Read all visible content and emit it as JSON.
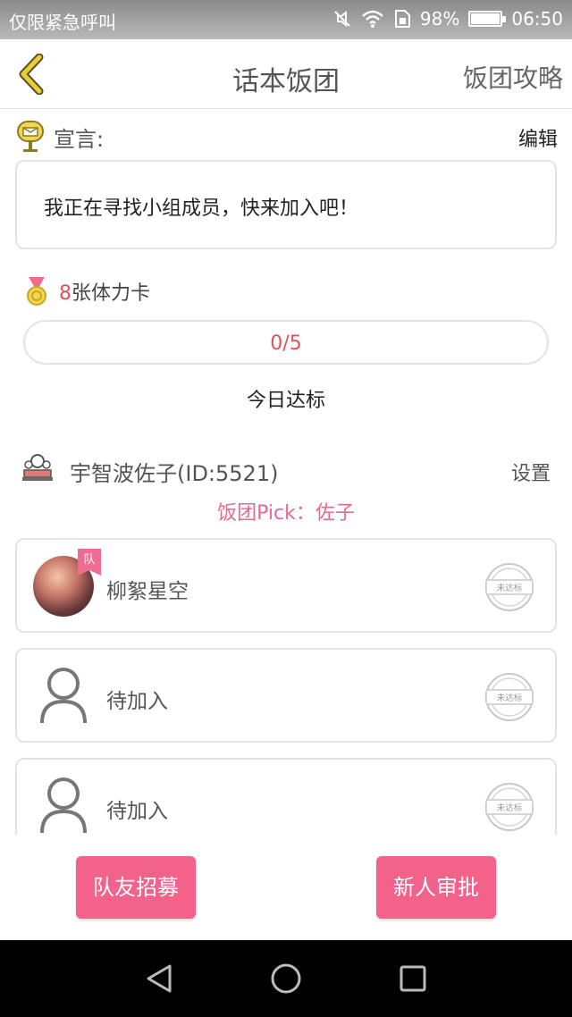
{
  "status_bar": {
    "left_text": "仅限紧急呼叫",
    "battery_text": "98%",
    "battery_level": 0.98,
    "time": "06:50",
    "icons": [
      "mute-icon",
      "wifi-icon",
      "sim-icon",
      "battery-icon"
    ]
  },
  "header": {
    "title": "话本饭团",
    "right_link": "饭团攻略",
    "back_icon": "chevron-left-icon",
    "accent_color": "#e8cf3a"
  },
  "declaration": {
    "label": "宣言:",
    "edit": "编辑",
    "text": "我正在寻找小组成员，快来加入吧！"
  },
  "cards": {
    "count": "8",
    "suffix": "张体力卡",
    "progress_text": "0/5",
    "progress_fraction": 0,
    "daily_label": "今日达标"
  },
  "team": {
    "name": "宇智波佐子(ID:5521)",
    "settings": "设置",
    "pick": "饭团Pick：佐子",
    "members": [
      {
        "name": "柳絮星空",
        "captain_badge": "队",
        "stamp": "未达标",
        "has_avatar": true
      },
      {
        "name": "待加入",
        "stamp": "未达标",
        "has_avatar": false
      },
      {
        "name": "待加入",
        "stamp": "未达标",
        "has_avatar": false
      }
    ]
  },
  "actions": {
    "recruit": "队友招募",
    "approve": "新人审批",
    "button_color": "#f2628a"
  },
  "nav_bar": {
    "icons": [
      "back-triangle-icon",
      "home-circle-icon",
      "recent-square-icon"
    ]
  }
}
